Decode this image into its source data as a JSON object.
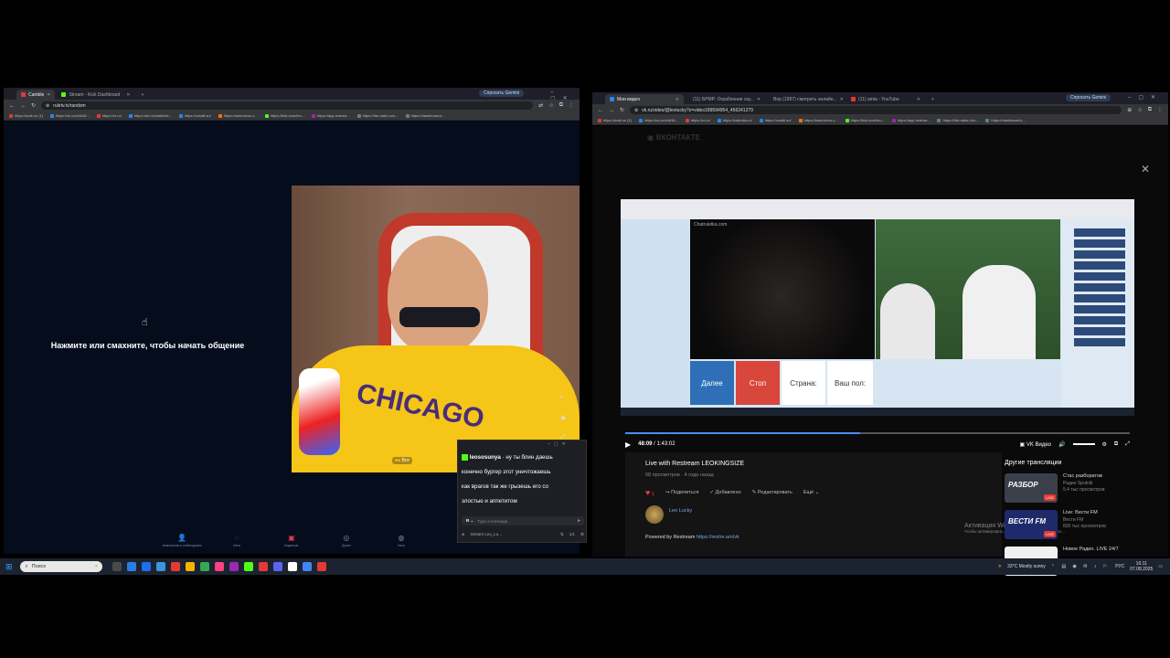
{
  "left_browser": {
    "tabs": [
      {
        "label": "Camble",
        "color": "#e53935"
      },
      {
        "label": "Stream - Kick Dashboard",
        "color": "#53fc18"
      }
    ],
    "new_tab": "+",
    "gemini": "Спросить Gemini",
    "url": "ruletv.tv/random",
    "bookmarks": [
      "https://mail.ru/ (1)",
      "https://vk.com/id18...",
      "https://rz.ru/",
      "https://ok.ru/chatlivek...",
      "https://coralil.su/",
      "https://www.temu.c...",
      "https://kick.com/leo...",
      "https://app.restrea...",
      "https://the-radio.ru/s...",
      "https://dashboard.k..."
    ]
  },
  "chat_site": {
    "prompt": "Нажмите или смахните, чтобы начать общение",
    "overlay_filter": "Все",
    "nav": [
      {
        "icon": "contacts-icon",
        "label": "знакомства и собеседники"
      },
      {
        "icon": "chat-icon",
        "label": "Чаты"
      },
      {
        "icon": "video-icon",
        "label": "Видеочат"
      },
      {
        "icon": "gift-icon",
        "label": "Донат"
      },
      {
        "icon": "messages-icon",
        "label": "Чаты"
      }
    ]
  },
  "kick_chat": {
    "username": "leososunya",
    "message_first": "ну ты блин даешь",
    "message_rest": [
      "конечно бургер этот уничтожаешь",
      "как врагов так же грызешь его со",
      "злостью и аппетитом"
    ],
    "input_placeholder": "Type a message...",
    "footer_name": "Stream Leo_Lu...",
    "footer_count": "1/1"
  },
  "right_browser": {
    "tabs": [
      {
        "label": "Мои видео",
        "color": "#2787f5"
      },
      {
        "label": "(11) БРМР: Ограбление ску...",
        "color": "#e53935"
      },
      {
        "label": "Вор (1997) смотреть онлайн...",
        "color": "#9e9e9e"
      },
      {
        "label": "(11) amia - YouTube",
        "color": "#e53935"
      }
    ],
    "new_tab": "+",
    "gemini": "Спросить Gemini",
    "url": "vk.ru/video/@leolucky?z=video189594954_456241279",
    "bookmarks": [
      "https://mail.ru/ (1)",
      "https://vk.com/id18...",
      "https://rz.ru/",
      "https://rzstudio.ru/",
      "https://coralil.su/",
      "https://www.temu.c...",
      "https://kick.com/leo...",
      "https://app.restrea...",
      "https://the-radio.ru/s...",
      "https://dashboard.k..."
    ]
  },
  "vk": {
    "logo": "ВКОНТАКТЕ",
    "video_inner": {
      "site": "Chatruletka.com",
      "btn_next": "Далее",
      "btn_stop": "Стоп",
      "country_label": "Страна:",
      "gender_label": "Ваш пол:"
    },
    "time_current": "48:09",
    "time_total": "1:43:02",
    "progress": 0.466,
    "vk_video_label": "VK Видео",
    "title": "Live with Restream LEOKINGSIZE",
    "views": "68 просмотров",
    "age": "4 года назад",
    "likes": "1",
    "share": "Поделиться",
    "added": "Добавлено",
    "edit": "Редактировать",
    "more": "Ещё",
    "author": "Leo Lucky",
    "powered_prefix": "Powered by Restream",
    "powered_link": "https://restre.am/vk",
    "activation_title": "Активация Windows",
    "activation_sub": "Чтобы активировать Windows, перейдите в раздел...",
    "other_title": "Другие трансляции",
    "other": [
      {
        "title": "Стас разборатов",
        "channel": "Радио Sputnik",
        "views": "5,4 тыс просмотров",
        "badge": "LIVE",
        "thumb": "#3b3f4a",
        "caption": "РАЗБОР"
      },
      {
        "title": "Live: Вести FM",
        "channel": "Вести FM",
        "views": "836 тыс просмотров",
        "badge": "LIVE",
        "thumb": "#1f2a6b",
        "caption": "ВЕСТИ FM"
      },
      {
        "title": "Новое Радио. LIVE 24/7",
        "channel": "",
        "views": "",
        "badge": "",
        "thumb": "#f0f0f0",
        "caption": ""
      }
    ]
  },
  "taskbar": {
    "search": "Поиск",
    "weather": "33°C  Mostly sunny",
    "lang": "РУС",
    "time": "16:11",
    "date": "07.08.2025"
  }
}
